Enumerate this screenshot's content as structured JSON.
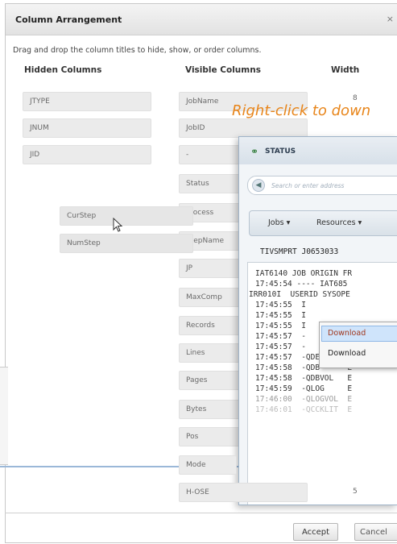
{
  "dialog": {
    "title": "Column Arrangement",
    "close_label": "×",
    "instructions": "Drag and drop the column titles to hide, show, or order columns.",
    "hidden_header": "Hidden Columns",
    "visible_header": "Visible Columns",
    "width_header": "Width"
  },
  "hidden_columns": [
    "JTYPE",
    "JNUM",
    "JID"
  ],
  "dragging_columns": [
    "CurStep",
    "NumStep"
  ],
  "visible_columns": [
    {
      "name": "JobName",
      "width": "8"
    },
    {
      "name": "JobID",
      "width": ""
    },
    {
      "name": "-",
      "width": ""
    },
    {
      "name": "Status",
      "width": ""
    },
    {
      "name": "Process",
      "width": ""
    },
    {
      "name": "StepName",
      "width": ""
    },
    {
      "name": "JP",
      "width": ""
    },
    {
      "name": "MaxComp",
      "width": ""
    },
    {
      "name": "Records",
      "width": ""
    },
    {
      "name": "Lines",
      "width": ""
    },
    {
      "name": "Pages",
      "width": ""
    },
    {
      "name": "Bytes",
      "width": ""
    },
    {
      "name": "Pos",
      "width": ""
    },
    {
      "name": "Mode",
      "width": ""
    },
    {
      "name": "H-OSE",
      "width": "5"
    }
  ],
  "buttons": {
    "accept": "Accept",
    "cancel": "Cancel"
  },
  "hint": "Right-click to down",
  "overlay": {
    "title": "STATUS",
    "logo_icon": "status-logo-icon",
    "address_placeholder": "Search or enter address",
    "menus": [
      "Jobs ▾",
      "Resources ▾"
    ],
    "job_line": "TIVSMPRT J0653033",
    "log_lines": [
      "IAT6140 JOB ORIGIN FR",
      "17:45:54 ---- IAT685",
      "IRR010I  USERID SYSOPE",
      "17:45:55  I",
      "17:45:55  I",
      "17:45:55  I",
      "17:45:57  -",
      "17:45:57  -",
      "17:45:57  -QDEVCLAS E",
      "17:45:58  -QDB      E",
      "17:45:58  -QDBVOL   E",
      "17:45:59  -QLOG     E",
      "17:46:00  -QLOGVOL  E",
      "17:46:01  -QCCKLIT  E"
    ],
    "context_menu": [
      "Download",
      "Download"
    ]
  },
  "colors": {
    "hint": "#e8851a",
    "menu_highlight": "#cfe4fb",
    "accent_blue": "#9bb8d8"
  }
}
